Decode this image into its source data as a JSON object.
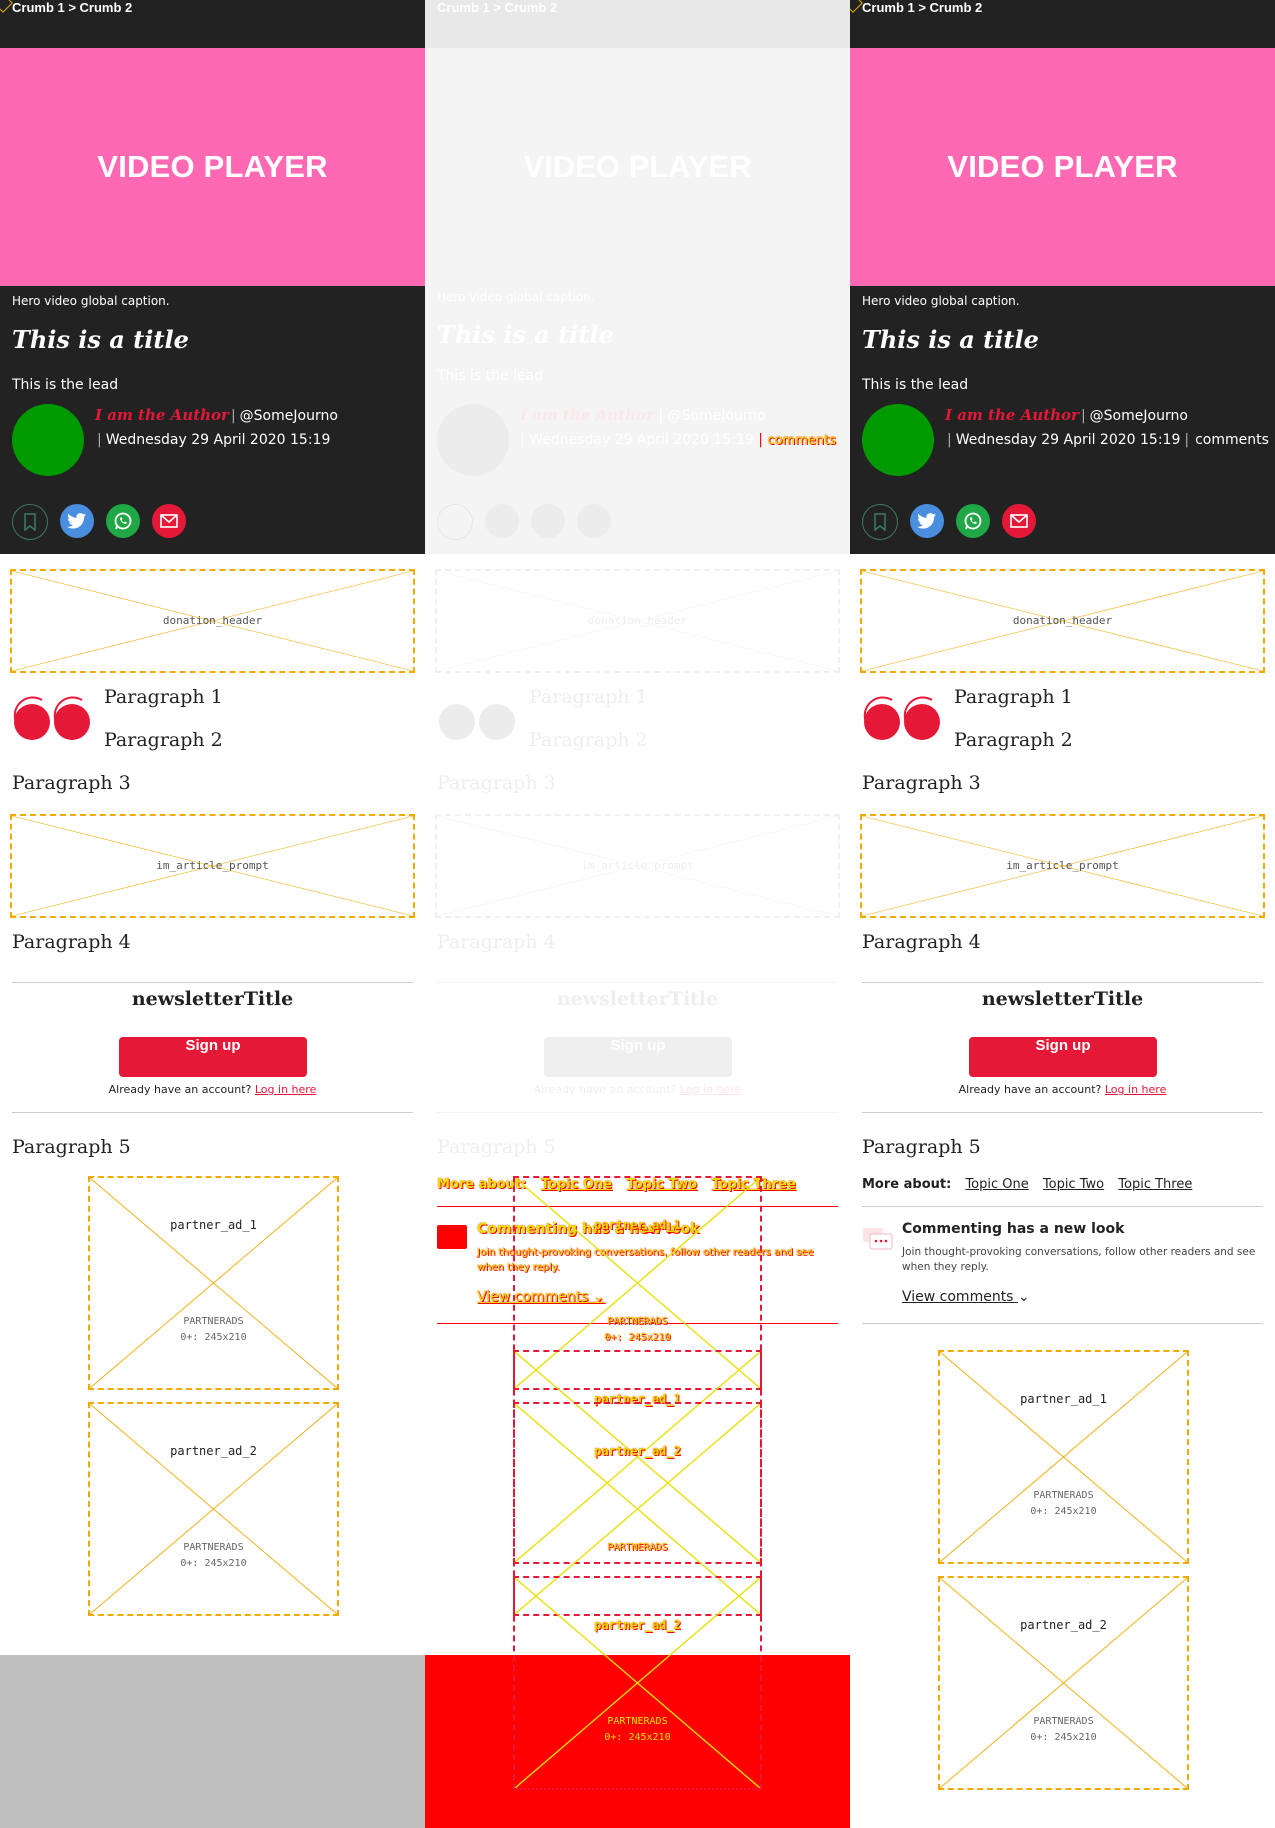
{
  "breadcrumb": "Crumb 1 > Crumb 2",
  "video_label": "VIDEO PLAYER",
  "caption": "Hero video global caption.",
  "title": "This is a title",
  "lead": "This is the lead",
  "author": "I am the Author",
  "handle": "@SomeJourno",
  "date": "Wednesday 29 April 2020 15:19",
  "comments_label": "comments",
  "share_icons": [
    "bookmark-icon",
    "twitter-icon",
    "whatsapp-icon",
    "email-icon"
  ],
  "placeholders": {
    "donation": "donation_header",
    "prompt": "im_article_prompt",
    "partner1": "partner_ad_1",
    "partner2": "partner_ad_2",
    "partner_sub1": "PARTNERADS",
    "partner_sub2": "0+: 245x210"
  },
  "paragraphs": [
    "Paragraph 1",
    "Paragraph 2",
    "Paragraph 3",
    "Paragraph 4",
    "Paragraph 5"
  ],
  "newsletter": {
    "title": "newsletterTitle",
    "signup": "Sign up",
    "already": "Already have an account?",
    "login": "Log in here"
  },
  "more_about": {
    "label": "More about:",
    "topics": [
      "Topic One",
      "Topic Two",
      "Topic Three"
    ]
  },
  "comments_promo": {
    "title": "Commenting has a new look",
    "desc": "Join thought-provoking conversations, follow other readers and see when they reply.",
    "view": "View comments"
  },
  "colors": {
    "dark": "#222222",
    "video": "#ff69b4",
    "accent": "#e51937",
    "placeholder": "#f2a900",
    "avatar": "#009900"
  }
}
